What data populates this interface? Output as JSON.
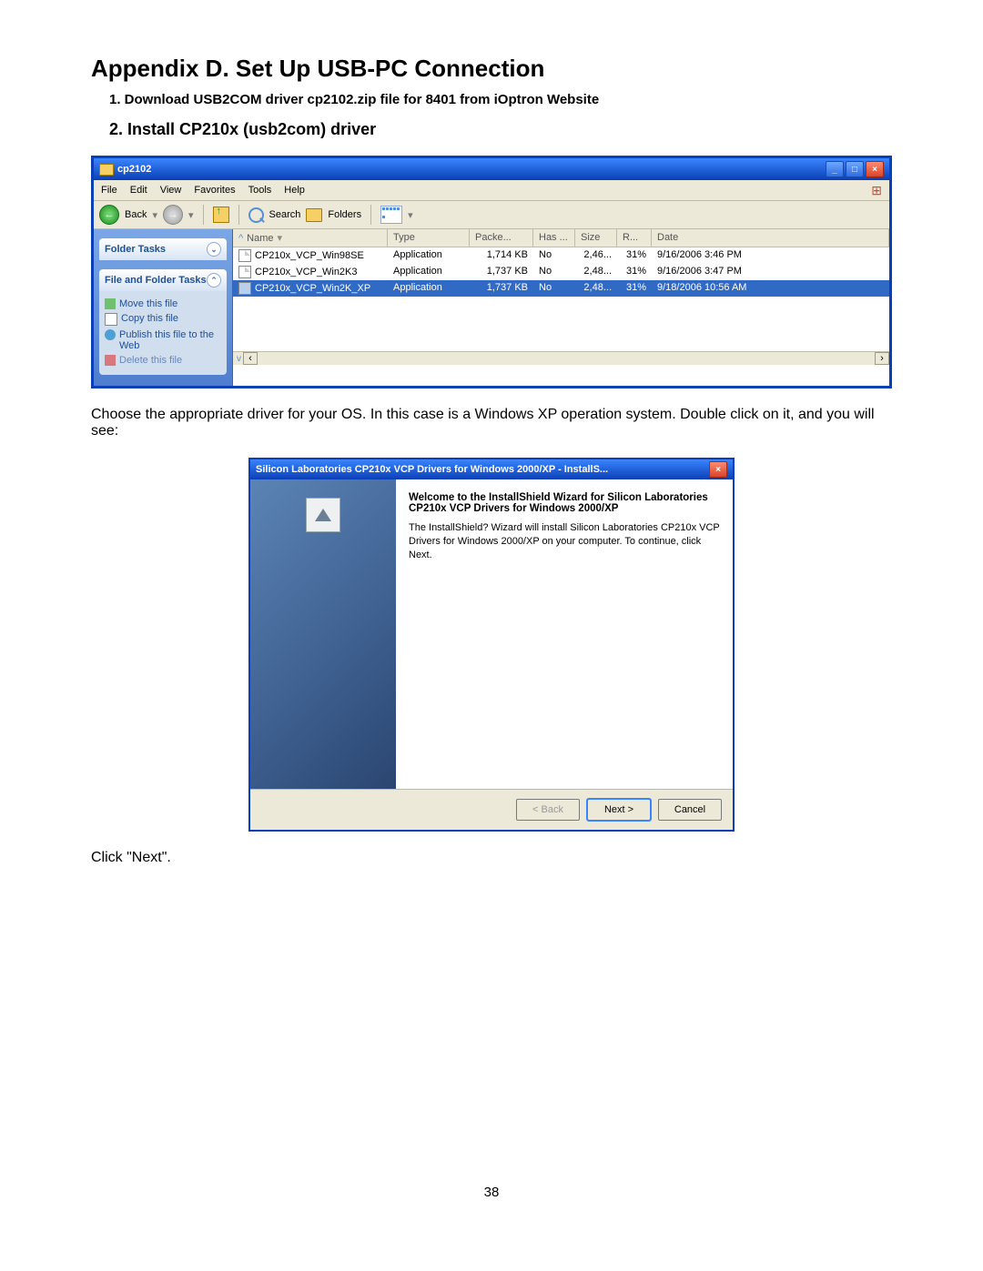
{
  "heading": "Appendix D. Set Up USB-PC Connection",
  "step1": "1.  Download USB2COM driver cp2102.zip file for 8401 from iOptron Website",
  "step2": "2.  Install CP210x (usb2com) driver",
  "body_text_1": "Choose the appropriate driver for your OS. In this case is a Windows XP operation system. Double click on it, and you will see:",
  "body_text_2": "Click \"Next\".",
  "page_number": "38",
  "explorer": {
    "title": "cp2102",
    "menus": [
      "File",
      "Edit",
      "View",
      "Favorites",
      "Tools",
      "Help"
    ],
    "toolbar": {
      "back": "Back",
      "search": "Search",
      "folders": "Folders"
    },
    "sidebar": {
      "panel1": {
        "title": "Folder Tasks"
      },
      "panel2": {
        "title": "File and Folder Tasks",
        "items": [
          "Move this file",
          "Copy this file",
          "Publish this file to the Web",
          "Delete this file"
        ]
      }
    },
    "columns": [
      "Name",
      "Type",
      "Packe...",
      "Has ...",
      "Size",
      "R...",
      "Date"
    ],
    "rows": [
      {
        "name": "CP210x_VCP_Win98SE",
        "type": "Application",
        "pack": "1,714 KB",
        "has": "No",
        "size": "2,46...",
        "ratio": "31%",
        "date": "9/16/2006 3:46 PM",
        "sel": false
      },
      {
        "name": "CP210x_VCP_Win2K3",
        "type": "Application",
        "pack": "1,737 KB",
        "has": "No",
        "size": "2,48...",
        "ratio": "31%",
        "date": "9/16/2006 3:47 PM",
        "sel": false
      },
      {
        "name": "CP210x_VCP_Win2K_XP",
        "type": "Application",
        "pack": "1,737 KB",
        "has": "No",
        "size": "2,48...",
        "ratio": "31%",
        "date": "9/18/2006 10:56 AM",
        "sel": true
      }
    ]
  },
  "installer": {
    "title": "Silicon Laboratories CP210x VCP Drivers for Windows 2000/XP - InstallS...",
    "welcome": "Welcome to the InstallShield Wizard for Silicon Laboratories CP210x VCP Drivers for Windows 2000/XP",
    "desc": "The InstallShield? Wizard will install Silicon Laboratories CP210x VCP Drivers for Windows 2000/XP on your computer.  To continue, click Next.",
    "buttons": {
      "back": "< Back",
      "next": "Next >",
      "cancel": "Cancel"
    }
  }
}
